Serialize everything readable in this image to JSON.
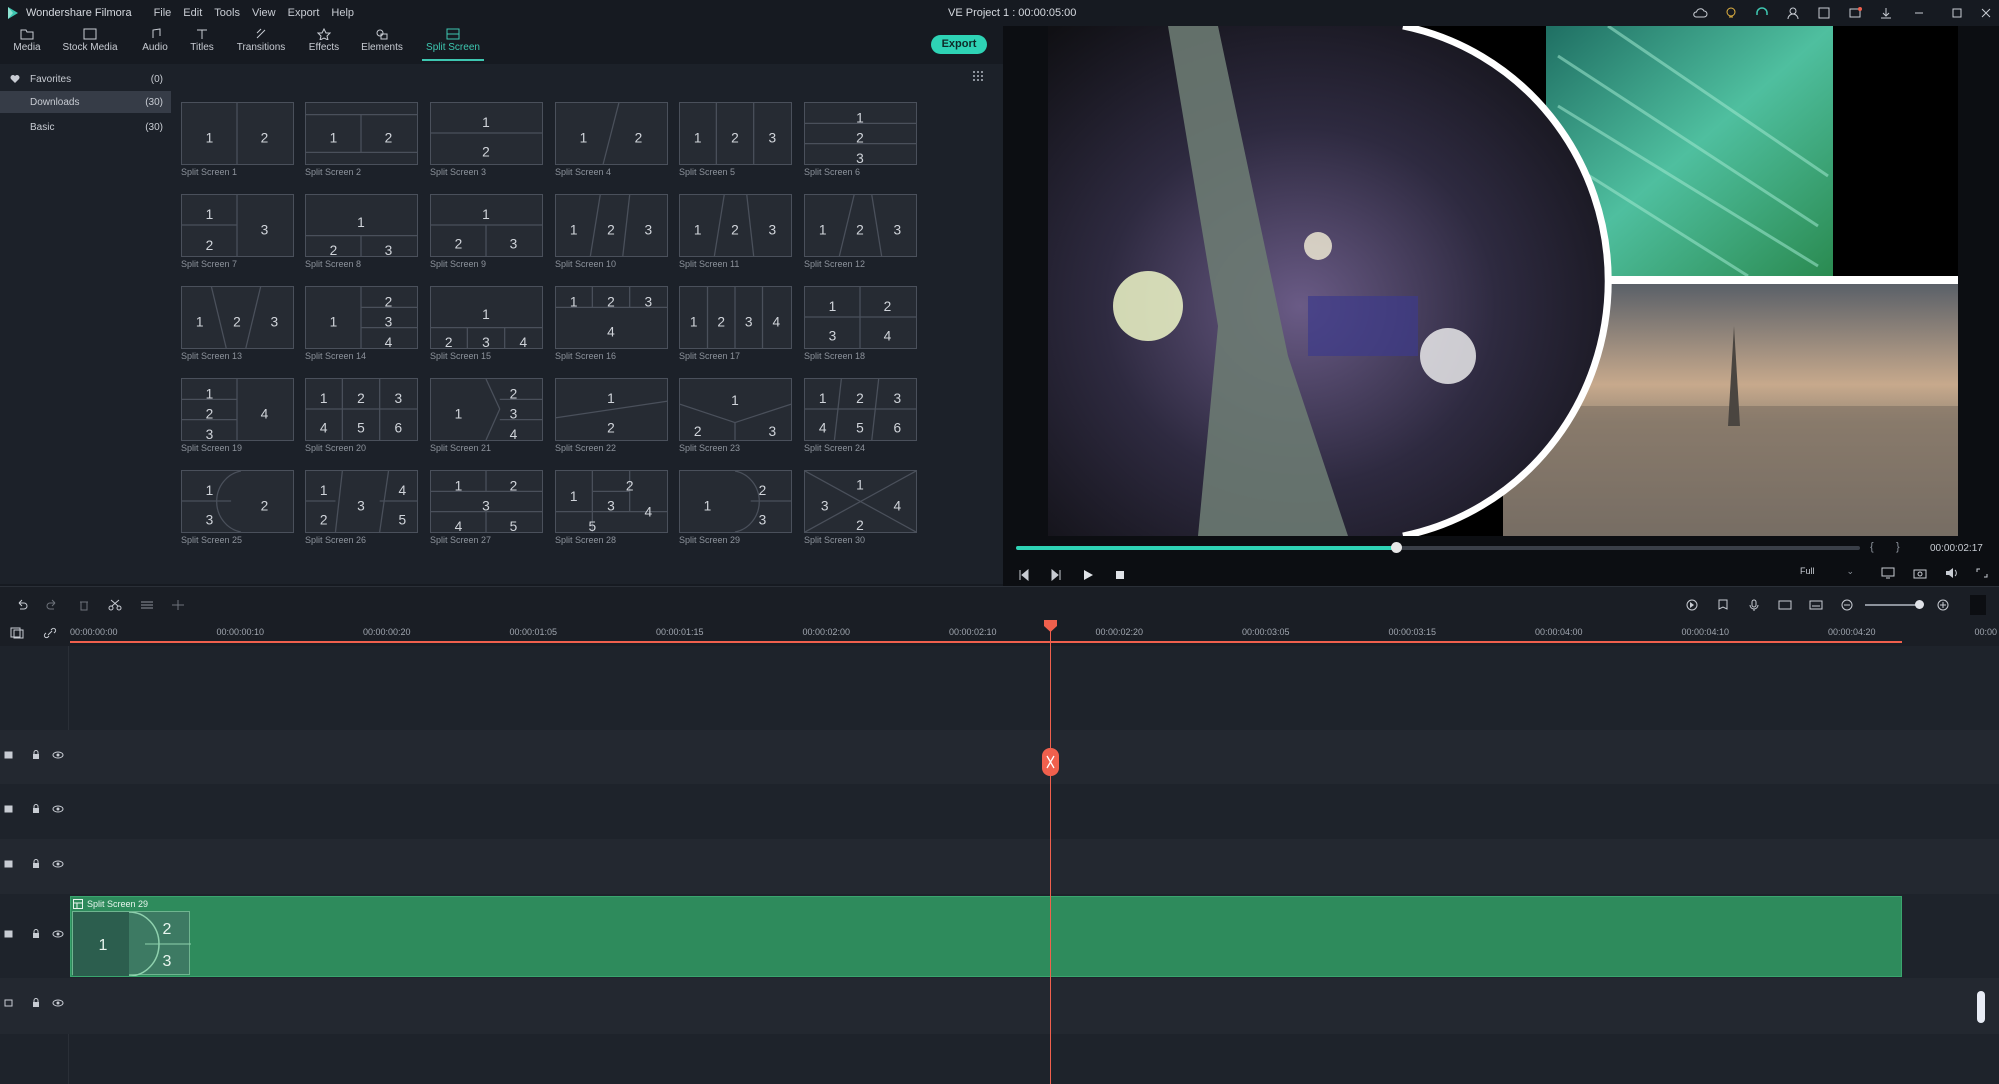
{
  "app": {
    "title": "Wondershare Filmora",
    "project_title": "VE Project 1 : 00:00:05:00",
    "menu": [
      "File",
      "Edit",
      "Tools",
      "View",
      "Export",
      "Help"
    ]
  },
  "toolbar": {
    "tabs": [
      {
        "label": "Media",
        "icon": "folder-icon"
      },
      {
        "label": "Stock Media",
        "icon": "stock-media-icon"
      },
      {
        "label": "Audio",
        "icon": "music-note-icon"
      },
      {
        "label": "Titles",
        "icon": "text-t-icon"
      },
      {
        "label": "Transitions",
        "icon": "transition-icon"
      },
      {
        "label": "Effects",
        "icon": "effects-icon"
      },
      {
        "label": "Elements",
        "icon": "elements-icon"
      },
      {
        "label": "Split Screen",
        "icon": "split-screen-icon"
      }
    ],
    "active_tab": "Split Screen",
    "export_label": "Export"
  },
  "library": {
    "categories": [
      {
        "label": "Favorites",
        "count": "(0)"
      },
      {
        "label": "Downloads",
        "count": "(30)"
      },
      {
        "label": "Basic",
        "count": "(30)"
      }
    ],
    "selected_category": "Downloads",
    "items": [
      {
        "label": "Split Screen 1"
      },
      {
        "label": "Split Screen 2"
      },
      {
        "label": "Split Screen 3"
      },
      {
        "label": "Split Screen 4"
      },
      {
        "label": "Split Screen 5"
      },
      {
        "label": "Split Screen 6"
      },
      {
        "label": "Split Screen 7"
      },
      {
        "label": "Split Screen 8"
      },
      {
        "label": "Split Screen 9"
      },
      {
        "label": "Split Screen 10"
      },
      {
        "label": "Split Screen 11"
      },
      {
        "label": "Split Screen 12"
      },
      {
        "label": "Split Screen 13"
      },
      {
        "label": "Split Screen 14"
      },
      {
        "label": "Split Screen 15"
      },
      {
        "label": "Split Screen 16"
      },
      {
        "label": "Split Screen 17"
      },
      {
        "label": "Split Screen 18"
      },
      {
        "label": "Split Screen 19"
      },
      {
        "label": "Split Screen 20"
      },
      {
        "label": "Split Screen 21"
      },
      {
        "label": "Split Screen 22"
      },
      {
        "label": "Split Screen 23"
      },
      {
        "label": "Split Screen 24"
      },
      {
        "label": "Split Screen 25"
      },
      {
        "label": "Split Screen 26"
      },
      {
        "label": "Split Screen 27"
      },
      {
        "label": "Split Screen 28"
      },
      {
        "label": "Split Screen 29"
      },
      {
        "label": "Split Screen 30"
      }
    ]
  },
  "preview": {
    "time": "00:00:02:17",
    "quality": "Full",
    "progress": 0.45
  },
  "timeline": {
    "ruler_ticks": [
      "00:00:00:00",
      "00:00:00:10",
      "00:00:00:20",
      "00:00:01:05",
      "00:00:01:15",
      "00:00:02:00",
      "00:00:02:10",
      "00:00:02:20",
      "00:00:03:05",
      "00:00:03:15",
      "00:00:04:00",
      "00:00:04:10",
      "00:00:04:20",
      "00:00"
    ],
    "clip_label": "Split Screen 29",
    "clip_thumb_digits": [
      "1",
      "2",
      "3"
    ]
  },
  "colors": {
    "accent": "#2ed3b5",
    "playhead": "#f0604d",
    "clip": "#2e8b5c"
  }
}
